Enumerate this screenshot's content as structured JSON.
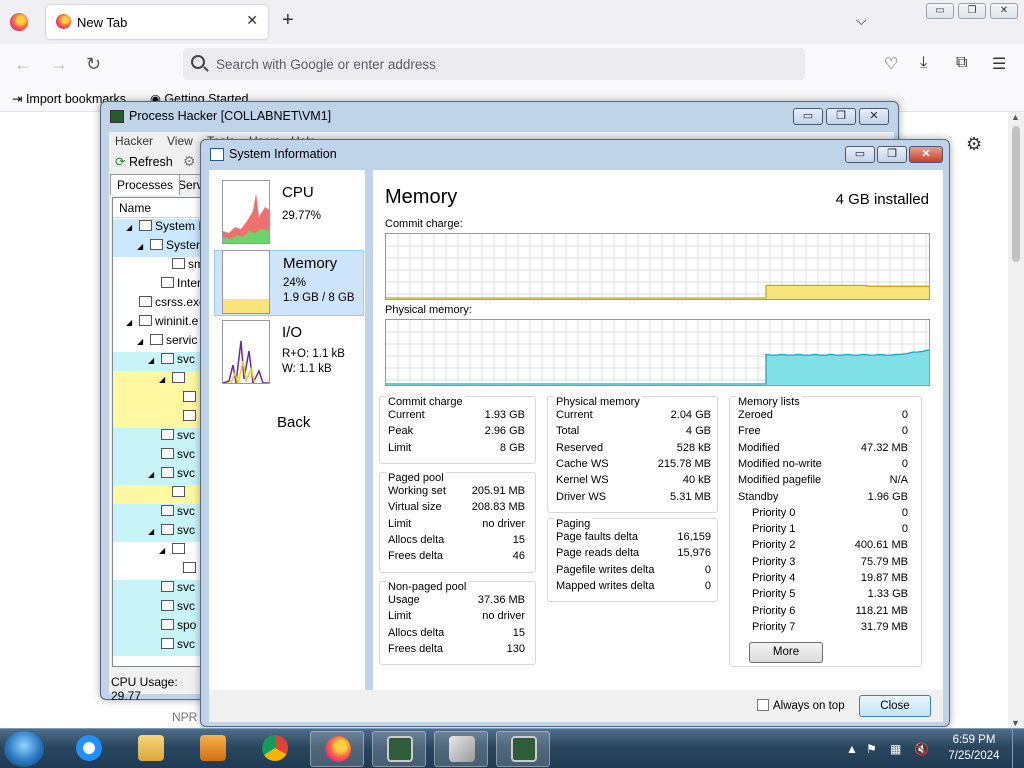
{
  "browser": {
    "tab_title": "New Tab",
    "tab_close": "✕",
    "new_tab": "+",
    "list_tabs": "⌵",
    "url_placeholder": "Search with Google or enter address",
    "bookmarks": [
      {
        "label": "Import bookmarks..."
      },
      {
        "label": "Getting Started"
      }
    ],
    "page_text": "NPR",
    "window_controls": {
      "minimize": "▭",
      "restore": "❐",
      "close": "✕"
    }
  },
  "process_hacker": {
    "title": "Process Hacker [COLLABNET\\VM1]",
    "menu": [
      "Hacker",
      "View",
      "Tools",
      "Users",
      "Help"
    ],
    "toolbar": {
      "refresh": "Refresh"
    },
    "tabs": [
      "Processes",
      "Servi"
    ],
    "tree_header": "Name",
    "tree_rows": [
      {
        "label": "System I",
        "highlight": "sel",
        "indent": 1,
        "expander": "◢"
      },
      {
        "label": "Syster",
        "highlight": "sel",
        "indent": 2,
        "expander": "◢"
      },
      {
        "label": "sm",
        "highlight": "",
        "indent": 4,
        "expander": ""
      },
      {
        "label": "Interr",
        "highlight": "",
        "indent": 3,
        "expander": ""
      },
      {
        "label": "csrss.exe",
        "highlight": "",
        "indent": 1,
        "expander": ""
      },
      {
        "label": "wininit.e",
        "highlight": "",
        "indent": 1,
        "expander": "◢"
      },
      {
        "label": "servic",
        "highlight": "",
        "indent": 2,
        "expander": "◢"
      },
      {
        "label": "svc",
        "highlight": "cyan",
        "indent": 3,
        "expander": "◢"
      },
      {
        "label": "",
        "highlight": "yellow",
        "indent": 4,
        "expander": "◢"
      },
      {
        "label": "",
        "highlight": "yellow",
        "indent": 5,
        "expander": ""
      },
      {
        "label": "",
        "highlight": "yellow",
        "indent": 5,
        "expander": ""
      },
      {
        "label": "svc",
        "highlight": "cyan",
        "indent": 3,
        "expander": ""
      },
      {
        "label": "svc",
        "highlight": "cyan",
        "indent": 3,
        "expander": ""
      },
      {
        "label": "svc",
        "highlight": "cyan",
        "indent": 3,
        "expander": "◢"
      },
      {
        "label": "",
        "highlight": "yellow",
        "indent": 4,
        "expander": ""
      },
      {
        "label": "svc",
        "highlight": "cyan",
        "indent": 3,
        "expander": ""
      },
      {
        "label": "svc",
        "highlight": "cyan",
        "indent": 3,
        "expander": "◢"
      },
      {
        "label": "",
        "highlight": "",
        "indent": 4,
        "expander": "◢"
      },
      {
        "label": "",
        "highlight": "",
        "indent": 5,
        "expander": ""
      },
      {
        "label": "svc",
        "highlight": "cyan",
        "indent": 3,
        "expander": ""
      },
      {
        "label": "svc",
        "highlight": "cyan",
        "indent": 3,
        "expander": ""
      },
      {
        "label": "spo",
        "highlight": "cyan",
        "indent": 3,
        "expander": ""
      },
      {
        "label": "svc",
        "highlight": "cyan",
        "indent": 3,
        "expander": ""
      }
    ],
    "status": "CPU Usage: 29.77"
  },
  "system_info": {
    "title": "System Information",
    "nav": {
      "cpu": {
        "name": "CPU",
        "line1": "29.77%",
        "line2": ""
      },
      "memory": {
        "name": "Memory",
        "line1": "24%",
        "line2": "1.9 GB / 8 GB"
      },
      "io": {
        "name": "I/O",
        "line1": "R+O: 1.1 kB",
        "line2": "W: 1.1 kB"
      },
      "back": "Back"
    },
    "heading": "Memory",
    "installed": "4 GB installed",
    "commit_graph_label": "Commit charge:",
    "physical_graph_label": "Physical memory:",
    "commit_graph_level": 0.21,
    "physical_graph_level": 0.46,
    "colors": {
      "commit_fill": "#f8e47a",
      "commit_line": "#c8a800",
      "physical_fill": "#7fe0e8",
      "physical_line": "#18a8b8"
    },
    "panels": {
      "commit_charge": {
        "title": "Commit charge",
        "rows": [
          {
            "k": "Current",
            "v": "1.93 GB"
          },
          {
            "k": "Peak",
            "v": "2.96 GB"
          },
          {
            "k": "Limit",
            "v": "8 GB"
          }
        ]
      },
      "paged_pool": {
        "title": "Paged pool",
        "rows": [
          {
            "k": "Working set",
            "v": "205.91 MB"
          },
          {
            "k": "Virtual size",
            "v": "208.83 MB"
          },
          {
            "k": "Limit",
            "v": "no driver"
          },
          {
            "k": "Allocs delta",
            "v": "15"
          },
          {
            "k": "Frees delta",
            "v": "46"
          }
        ]
      },
      "non_paged_pool": {
        "title": "Non-paged pool",
        "rows": [
          {
            "k": "Usage",
            "v": "37.36 MB"
          },
          {
            "k": "Limit",
            "v": "no driver"
          },
          {
            "k": "Allocs delta",
            "v": "15"
          },
          {
            "k": "Frees delta",
            "v": "130"
          }
        ]
      },
      "physical_memory": {
        "title": "Physical memory",
        "rows": [
          {
            "k": "Current",
            "v": "2.04 GB"
          },
          {
            "k": "Total",
            "v": "4 GB"
          },
          {
            "k": "Reserved",
            "v": "528 kB"
          },
          {
            "k": "Cache WS",
            "v": "215.78 MB"
          },
          {
            "k": "Kernel WS",
            "v": "40 kB"
          },
          {
            "k": "Driver WS",
            "v": "5.31 MB"
          }
        ]
      },
      "paging": {
        "title": "Paging",
        "rows": [
          {
            "k": "Page faults delta",
            "v": "16,159"
          },
          {
            "k": "Page reads delta",
            "v": "15,976"
          },
          {
            "k": "Pagefile writes delta",
            "v": "0"
          },
          {
            "k": "Mapped writes delta",
            "v": "0"
          }
        ]
      },
      "memory_lists": {
        "title": "Memory lists",
        "rows": [
          {
            "k": "Zeroed",
            "v": "0"
          },
          {
            "k": "Free",
            "v": "0"
          },
          {
            "k": "Modified",
            "v": "47.32 MB"
          },
          {
            "k": "Modified no-write",
            "v": "0"
          },
          {
            "k": "Modified pagefile",
            "v": "N/A"
          },
          {
            "k": "Standby",
            "v": "1.96 GB"
          },
          {
            "k": "Priority 0",
            "v": "0"
          },
          {
            "k": "Priority 1",
            "v": "0"
          },
          {
            "k": "Priority 2",
            "v": "400.61 MB"
          },
          {
            "k": "Priority 3",
            "v": "75.79 MB"
          },
          {
            "k": "Priority 4",
            "v": "19.87 MB"
          },
          {
            "k": "Priority 5",
            "v": "1.33 GB"
          },
          {
            "k": "Priority 6",
            "v": "118.21 MB"
          },
          {
            "k": "Priority 7",
            "v": "31.79 MB"
          }
        ]
      }
    },
    "more_button": "More",
    "always_on_top": "Always on top",
    "close_button": "Close"
  },
  "taskbar": {
    "time": "6:59 PM",
    "date": "7/25/2024",
    "apps": [
      "internet-explorer",
      "file-explorer",
      "media-player",
      "chrome",
      "firefox",
      "process-hacker",
      "blank-window",
      "process-hacker-sysinfo"
    ]
  }
}
